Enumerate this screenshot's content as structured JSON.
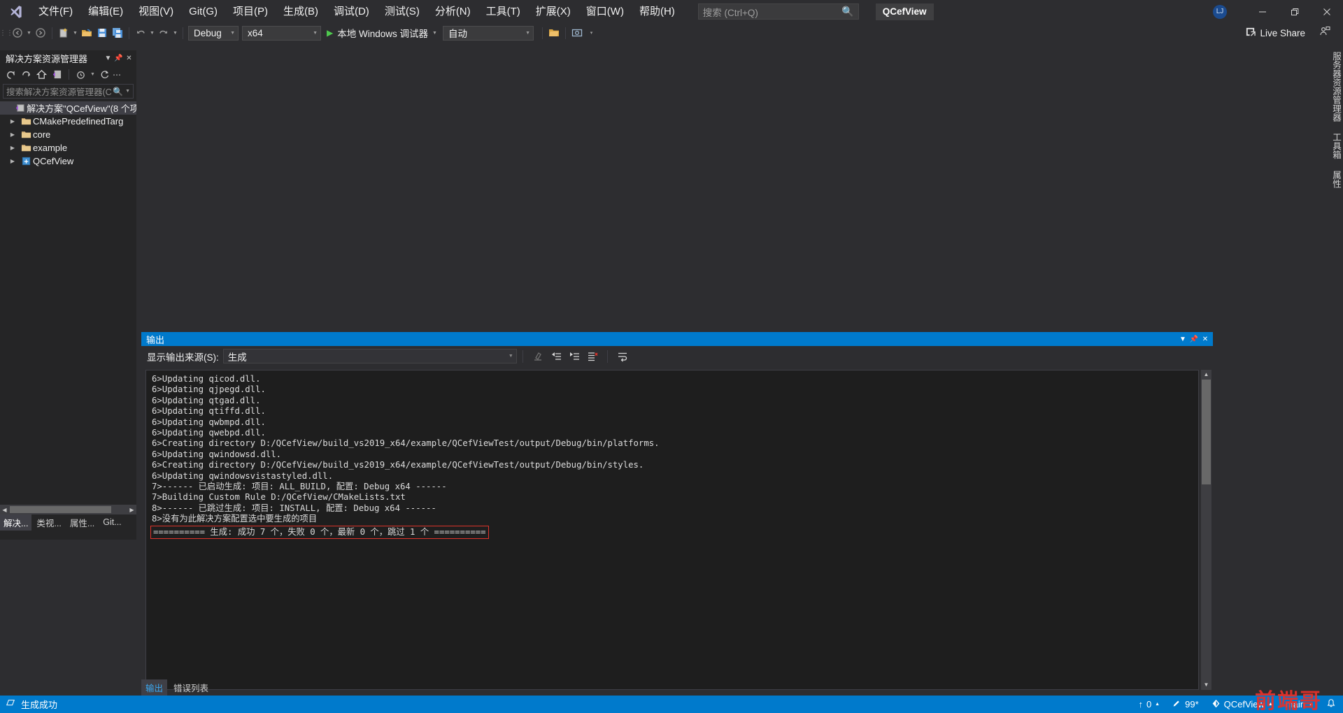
{
  "app": {
    "window_title": "QCefView",
    "logo_icon": "visual-studio-logo"
  },
  "menu": {
    "items": [
      {
        "label": "文件(F)"
      },
      {
        "label": "编辑(E)"
      },
      {
        "label": "视图(V)"
      },
      {
        "label": "Git(G)"
      },
      {
        "label": "项目(P)"
      },
      {
        "label": "生成(B)"
      },
      {
        "label": "调试(D)"
      },
      {
        "label": "测试(S)"
      },
      {
        "label": "分析(N)"
      },
      {
        "label": "工具(T)"
      },
      {
        "label": "扩展(X)"
      },
      {
        "label": "窗口(W)"
      },
      {
        "label": "帮助(H)"
      }
    ]
  },
  "search": {
    "placeholder": "搜索 (Ctrl+Q)",
    "icon": "search-icon"
  },
  "window_controls": {
    "avatar_initials": "LJ",
    "minimize": "minimize-icon",
    "restore": "restore-icon",
    "close": "close-icon"
  },
  "toolbar": {
    "config_value": "Debug",
    "platform_value": "x64",
    "run_label": "本地 Windows 调试器",
    "attach_value": "自动",
    "live_share_label": "Live Share"
  },
  "solution_explorer": {
    "title": "解决方案资源管理器",
    "search_placeholder": "搜索解决方案资源管理器(C",
    "tree": [
      {
        "label": "解决方案\"QCefView\"(8 个项",
        "icon": "solution-icon",
        "indent": 0,
        "expander": "",
        "selected": true
      },
      {
        "label": "CMakePredefinedTarg",
        "icon": "folder-icon",
        "indent": 1,
        "expander": "▶",
        "selected": false
      },
      {
        "label": "core",
        "icon": "folder-icon",
        "indent": 1,
        "expander": "▶",
        "selected": false
      },
      {
        "label": "example",
        "icon": "folder-icon",
        "indent": 1,
        "expander": "▶",
        "selected": false
      },
      {
        "label": "QCefView",
        "icon": "project-icon",
        "indent": 1,
        "expander": "▶",
        "selected": false
      }
    ],
    "bottom_tabs": [
      {
        "label": "解决...",
        "active": true
      },
      {
        "label": "类视...",
        "active": false
      },
      {
        "label": "属性...",
        "active": false
      },
      {
        "label": "Git...",
        "active": false
      }
    ]
  },
  "output_panel": {
    "title": "输出",
    "source_label": "显示输出来源(S):",
    "source_value": "生成",
    "toolbar_icons": [
      "clear-all-icon",
      "go-to-previous-message-icon",
      "go-to-next-message-icon",
      "clear-pane-icon",
      "toggle-word-wrap-icon"
    ],
    "lines": [
      {
        "text": "6>Updating qicod.dll.",
        "boxed": false
      },
      {
        "text": "6>Updating qjpegd.dll.",
        "boxed": false
      },
      {
        "text": "6>Updating qtgad.dll.",
        "boxed": false
      },
      {
        "text": "6>Updating qtiffd.dll.",
        "boxed": false
      },
      {
        "text": "6>Updating qwbmpd.dll.",
        "boxed": false
      },
      {
        "text": "6>Updating qwebpd.dll.",
        "boxed": false
      },
      {
        "text": "6>Creating directory D:/QCefView/build_vs2019_x64/example/QCefViewTest/output/Debug/bin/platforms.",
        "boxed": false
      },
      {
        "text": "6>Updating qwindowsd.dll.",
        "boxed": false
      },
      {
        "text": "6>Creating directory D:/QCefView/build_vs2019_x64/example/QCefViewTest/output/Debug/bin/styles.",
        "boxed": false
      },
      {
        "text": "6>Updating qwindowsvistastyled.dll.",
        "boxed": false
      },
      {
        "text": "7>------ 已启动生成: 项目: ALL_BUILD, 配置: Debug x64 ------",
        "boxed": false
      },
      {
        "text": "7>Building Custom Rule D:/QCefView/CMakeLists.txt",
        "boxed": false
      },
      {
        "text": "8>------ 已跳过生成: 项目: INSTALL, 配置: Debug x64 ------",
        "boxed": false
      },
      {
        "text": "8>没有为此解决方案配置选中要生成的项目",
        "boxed": false
      },
      {
        "text": "========== 生成: 成功 7 个，失败 0 个，最新 0 个，跳过 1 个 ==========",
        "boxed": true
      }
    ],
    "bottom_tabs": [
      {
        "label": "输出",
        "active": true
      },
      {
        "label": "错误列表",
        "active": false
      }
    ],
    "highlight_color": "#e0342b"
  },
  "right_tabs": [
    {
      "label": "服务器资源管理器"
    },
    {
      "label": "工具箱"
    },
    {
      "label": "属性"
    }
  ],
  "status_bar": {
    "build_status": "生成成功",
    "status_icon": "build-ok-icon",
    "pending_changes": "0",
    "pending_icon": "up-arrow-icon",
    "edits": "99*",
    "edits_icon": "pencil-icon",
    "repo": "QCefView",
    "repo_icon": "source-control-icon",
    "branch": "main",
    "notifications_icon": "bell-icon",
    "accent_color": "#007acc"
  },
  "watermark": {
    "text": "前端哥"
  }
}
